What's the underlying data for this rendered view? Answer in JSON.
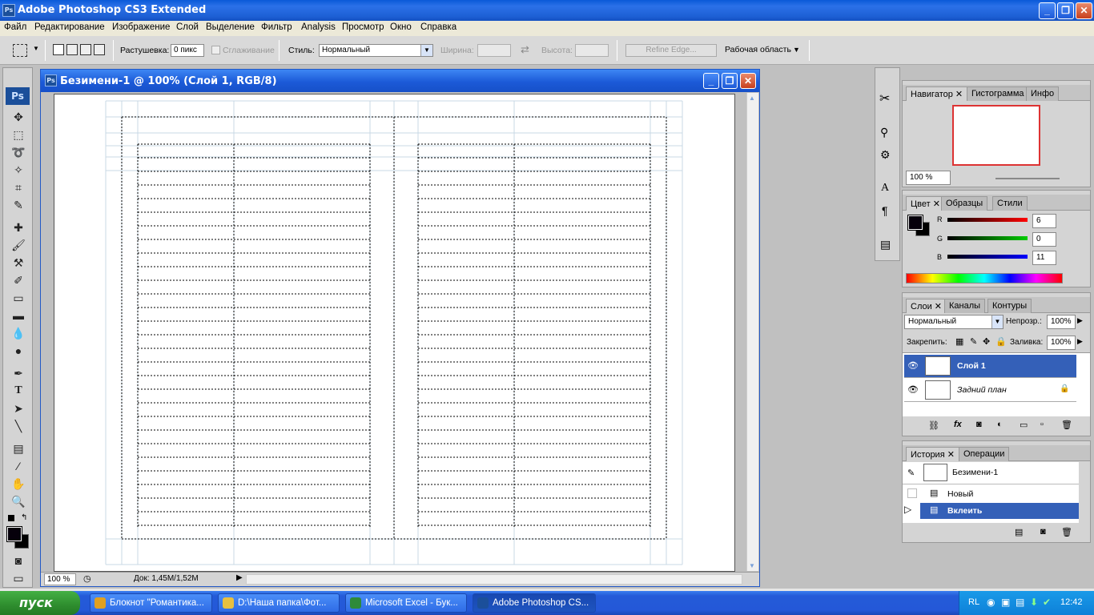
{
  "app": {
    "title": "Adobe Photoshop CS3 Extended",
    "ps_badge": "Ps",
    "window_buttons": {
      "minimize": "_",
      "restore": "❐",
      "close": "✕"
    }
  },
  "menu": [
    "Файл",
    "Редактирование",
    "Изображение",
    "Слой",
    "Выделение",
    "Фильтр",
    "Analysis",
    "Просмотр",
    "Окно",
    "Справка"
  ],
  "options": {
    "feather_label": "Растушевка:",
    "feather_value": "0 пикс",
    "antialias_label": "Сглаживание",
    "style_label": "Стиль:",
    "style_value": "Нормальный",
    "width_label": "Ширина:",
    "height_label": "Высота:",
    "refine_edge": "Refine Edge...",
    "workspace_label": "Рабочая область"
  },
  "document": {
    "title": "Безимени-1 @ 100% (Слой 1, RGB/8)",
    "zoom": "100 %",
    "doc_size": "Док: 1,45M/1,52M"
  },
  "navigator": {
    "tabs": [
      "Навигатор",
      "Гистограмма",
      "Инфо"
    ],
    "zoom": "100 %"
  },
  "color_panel": {
    "tabs": [
      "Цвет",
      "Образцы",
      "Стили"
    ],
    "r_label": "R",
    "g_label": "G",
    "b_label": "B",
    "r": "6",
    "g": "0",
    "b": "11"
  },
  "layers_panel": {
    "tabs": [
      "Слои",
      "Каналы",
      "Контуры"
    ],
    "blend_mode": "Нормальный",
    "opacity_label": "Непрозр.:",
    "opacity": "100%",
    "lock_label": "Закрепить:",
    "fill_label": "Заливка:",
    "fill": "100%",
    "layers": [
      {
        "name": "Слой 1",
        "selected": true
      },
      {
        "name": "Задний план",
        "selected": false
      }
    ]
  },
  "history_panel": {
    "tabs": [
      "История",
      "Операции"
    ],
    "snapshot": "Безимени-1",
    "items": [
      {
        "label": "Новый",
        "selected": false
      },
      {
        "label": "Вклеить",
        "selected": true
      }
    ]
  },
  "taskbar": {
    "start": "пуск",
    "tasks": [
      {
        "label": "Блокнот \"Романтика...",
        "color": "#e0a020"
      },
      {
        "label": "D:\\Наша папка\\Фот...",
        "color": "#e8c040"
      },
      {
        "label": "Microsoft Excel - Бук...",
        "color": "#2e8a3a"
      },
      {
        "label": "Adobe Photoshop CS...",
        "color": "#1b4f9a"
      }
    ],
    "lang": "RL",
    "clock": "12:42"
  }
}
